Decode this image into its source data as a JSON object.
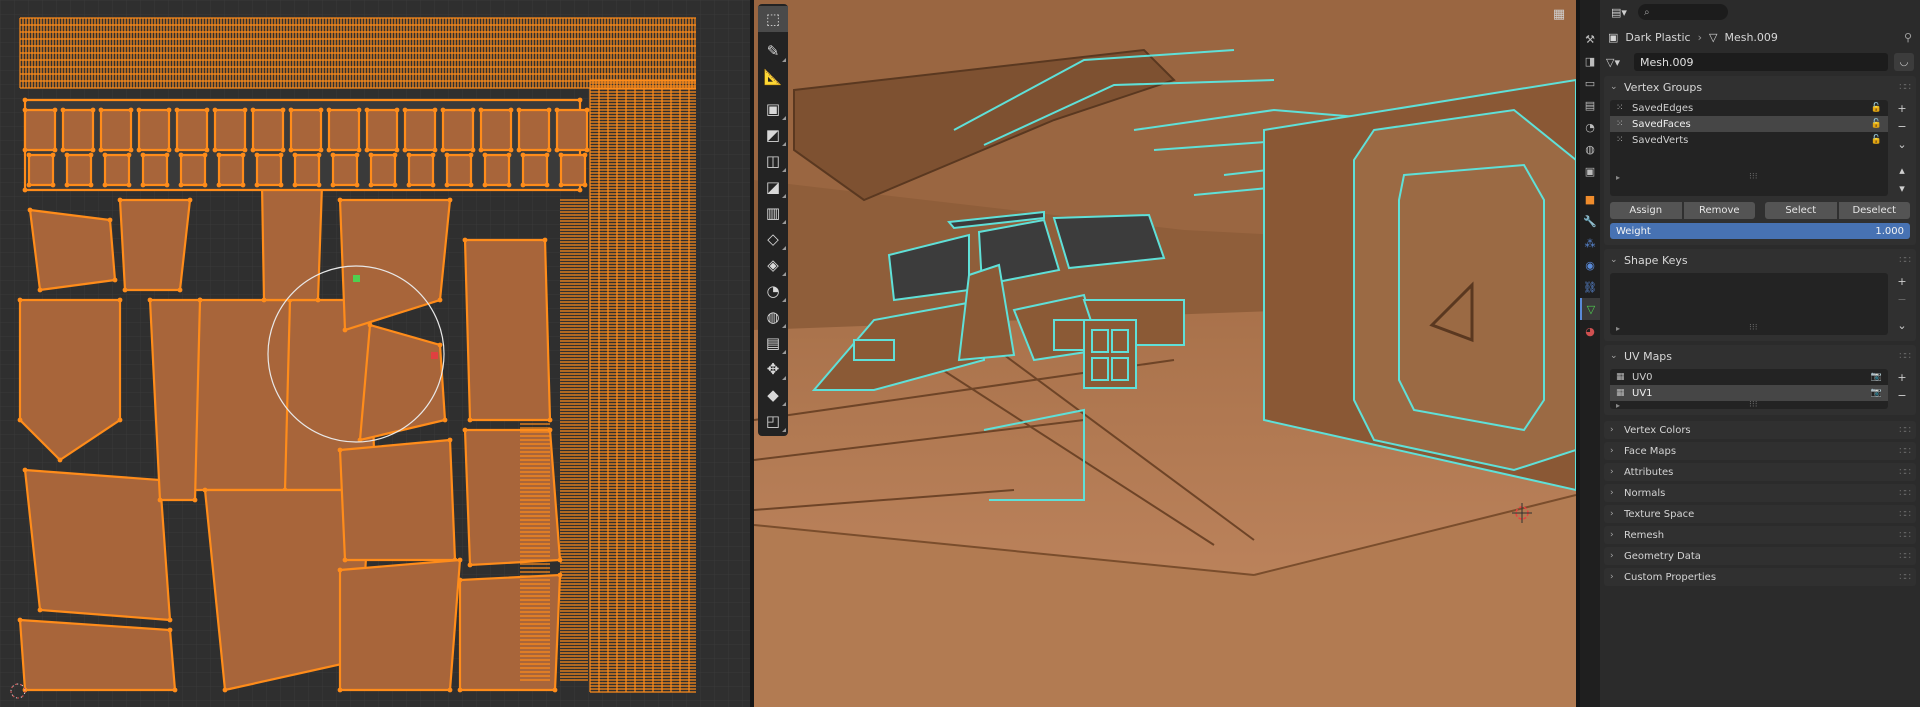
{
  "uv_editor": {
    "name": "UV Editor"
  },
  "viewport": {
    "toolbar": [
      {
        "name": "select-box-tool-icon",
        "glyph": "⬚"
      },
      {
        "name": "annotate-tool-icon",
        "glyph": "✎"
      },
      {
        "name": "measure-tool-icon",
        "glyph": "📐"
      },
      {
        "name": "add-cube-tool-icon",
        "glyph": "▣"
      },
      {
        "name": "extrude-tool-icon",
        "glyph": "◩"
      },
      {
        "name": "inset-tool-icon",
        "glyph": "◫"
      },
      {
        "name": "bevel-tool-icon",
        "glyph": "◪"
      },
      {
        "name": "loop-cut-tool-icon",
        "glyph": "▥"
      },
      {
        "name": "knife-tool-icon",
        "glyph": "◇"
      },
      {
        "name": "poly-build-tool-icon",
        "glyph": "◈"
      },
      {
        "name": "spin-tool-icon",
        "glyph": "◔"
      },
      {
        "name": "smooth-tool-icon",
        "glyph": "◍"
      },
      {
        "name": "edge-slide-tool-icon",
        "glyph": "▤"
      },
      {
        "name": "shrink-fatten-tool-icon",
        "glyph": "✥"
      },
      {
        "name": "shear-tool-icon",
        "glyph": "◆"
      },
      {
        "name": "rip-tool-icon",
        "glyph": "◰"
      }
    ]
  },
  "properties": {
    "header": {
      "search_placeholder": ""
    },
    "breadcrumb": {
      "object": "Dark Plastic",
      "mesh": "Mesh.009"
    },
    "datablock": {
      "name": "Mesh.009"
    },
    "vertex_groups": {
      "title": "Vertex Groups",
      "items": [
        "SavedEdges",
        "SavedFaces",
        "SavedVerts"
      ],
      "selected_index": 1,
      "buttons": {
        "assign": "Assign",
        "remove": "Remove",
        "select": "Select",
        "deselect": "Deselect"
      },
      "weight_label": "Weight",
      "weight_value": "1.000"
    },
    "shape_keys": {
      "title": "Shape Keys"
    },
    "uv_maps": {
      "title": "UV Maps",
      "items": [
        "UV0",
        "UV1"
      ],
      "selected_index": 1
    },
    "collapsed_panels": [
      "Vertex Colors",
      "Face Maps",
      "Attributes",
      "Normals",
      "Texture Space",
      "Remesh",
      "Geometry Data",
      "Custom Properties"
    ]
  },
  "colors": {
    "uv_orange": "#ff8c1a",
    "uv_background": "#2f2f2f",
    "wire_cyan": "#5fe0d8",
    "accent_blue": "#4772b3"
  }
}
